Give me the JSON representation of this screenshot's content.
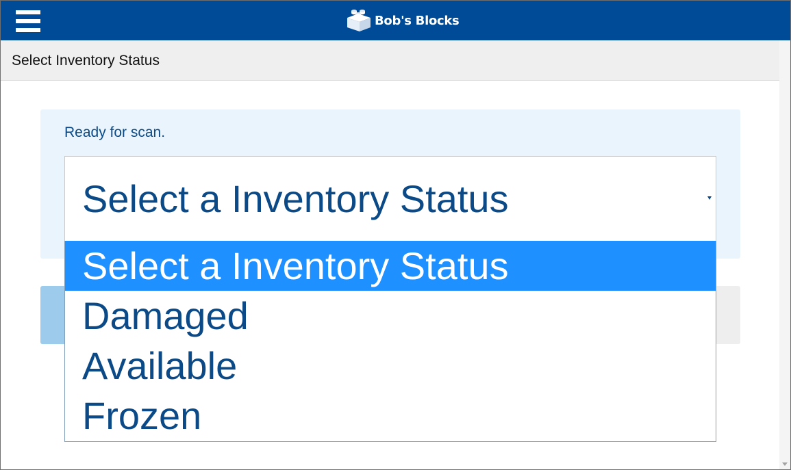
{
  "app": {
    "brand_name": "Bob's Blocks",
    "brand_color": "#004b97",
    "accent_color": "#1e90ff"
  },
  "header": {
    "menu_icon": "hamburger-menu-icon",
    "logo_icon": "lego-brick-icon"
  },
  "page": {
    "title": "Select Inventory Status"
  },
  "scan": {
    "status_text": "Ready for scan."
  },
  "select": {
    "current_value": "Select a Inventory Status",
    "arrow_icon": "dropdown-arrow-icon",
    "options": [
      {
        "label": "Select a Inventory Status",
        "selected": true
      },
      {
        "label": "Damaged",
        "selected": false
      },
      {
        "label": "Available",
        "selected": false
      },
      {
        "label": "Frozen",
        "selected": false
      }
    ]
  }
}
